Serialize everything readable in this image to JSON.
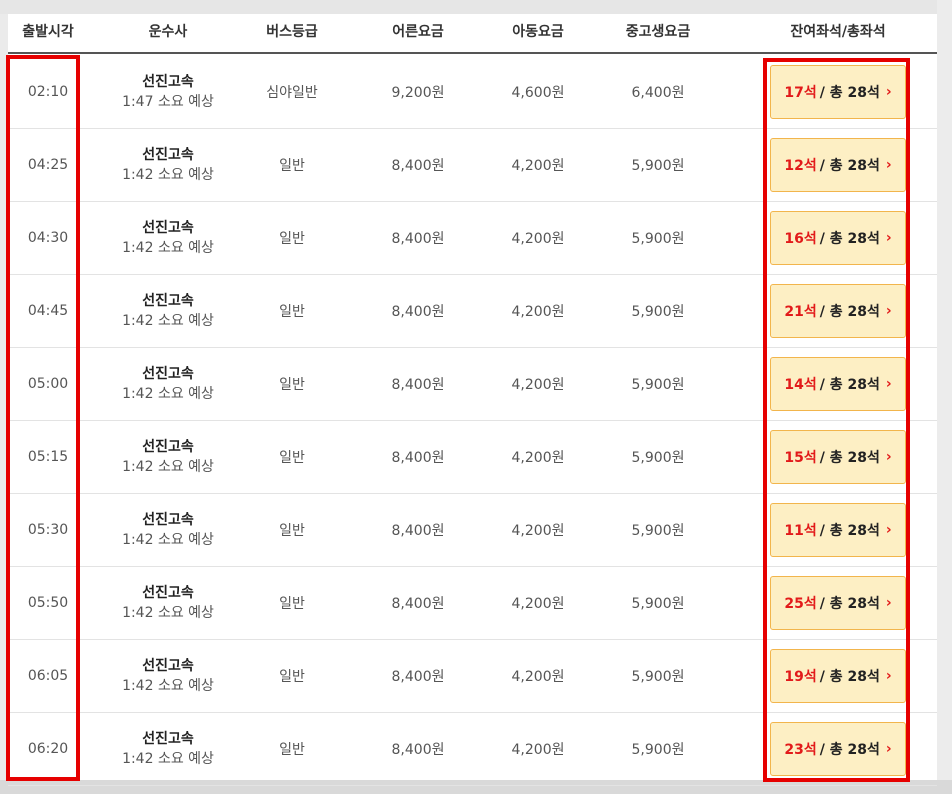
{
  "header": {
    "columns": [
      "출발시각",
      "운수사",
      "버스등급",
      "어른요금",
      "아동요금",
      "중고생요금",
      "잔여좌석/총좌석"
    ]
  },
  "rows": [
    {
      "time": "02:10",
      "operator": "선진고속",
      "duration": "1:47 소요 예상",
      "grade": "심야일반",
      "adult": "9,200원",
      "child": "4,600원",
      "teen": "6,400원",
      "remain": "17석",
      "total": "/ 총 28석"
    },
    {
      "time": "04:25",
      "operator": "선진고속",
      "duration": "1:42 소요 예상",
      "grade": "일반",
      "adult": "8,400원",
      "child": "4,200원",
      "teen": "5,900원",
      "remain": "12석",
      "total": "/ 총 28석"
    },
    {
      "time": "04:30",
      "operator": "선진고속",
      "duration": "1:42 소요 예상",
      "grade": "일반",
      "adult": "8,400원",
      "child": "4,200원",
      "teen": "5,900원",
      "remain": "16석",
      "total": "/ 총 28석"
    },
    {
      "time": "04:45",
      "operator": "선진고속",
      "duration": "1:42 소요 예상",
      "grade": "일반",
      "adult": "8,400원",
      "child": "4,200원",
      "teen": "5,900원",
      "remain": "21석",
      "total": "/ 총 28석"
    },
    {
      "time": "05:00",
      "operator": "선진고속",
      "duration": "1:42 소요 예상",
      "grade": "일반",
      "adult": "8,400원",
      "child": "4,200원",
      "teen": "5,900원",
      "remain": "14석",
      "total": "/ 총 28석"
    },
    {
      "time": "05:15",
      "operator": "선진고속",
      "duration": "1:42 소요 예상",
      "grade": "일반",
      "adult": "8,400원",
      "child": "4,200원",
      "teen": "5,900원",
      "remain": "15석",
      "total": "/ 총 28석"
    },
    {
      "time": "05:30",
      "operator": "선진고속",
      "duration": "1:42 소요 예상",
      "grade": "일반",
      "adult": "8,400원",
      "child": "4,200원",
      "teen": "5,900원",
      "remain": "11석",
      "total": "/ 총 28석"
    },
    {
      "time": "05:50",
      "operator": "선진고속",
      "duration": "1:42 소요 예상",
      "grade": "일반",
      "adult": "8,400원",
      "child": "4,200원",
      "teen": "5,900원",
      "remain": "25석",
      "total": "/ 총 28석"
    },
    {
      "time": "06:05",
      "operator": "선진고속",
      "duration": "1:42 소요 예상",
      "grade": "일반",
      "adult": "8,400원",
      "child": "4,200원",
      "teen": "5,900원",
      "remain": "19석",
      "total": "/ 총 28석"
    },
    {
      "time": "06:20",
      "operator": "선진고속",
      "duration": "1:42 소요 예상",
      "grade": "일반",
      "adult": "8,400원",
      "child": "4,200원",
      "teen": "5,900원",
      "remain": "23석",
      "total": "/ 총 28석"
    }
  ],
  "icons": {
    "seat_chevron": "chevron-right-icon"
  },
  "colors": {
    "remain_red": "#e21a1a",
    "seat_button_bg": "#fdefc4",
    "seat_button_border": "#f2b54c",
    "highlight_box": "#e60000"
  }
}
